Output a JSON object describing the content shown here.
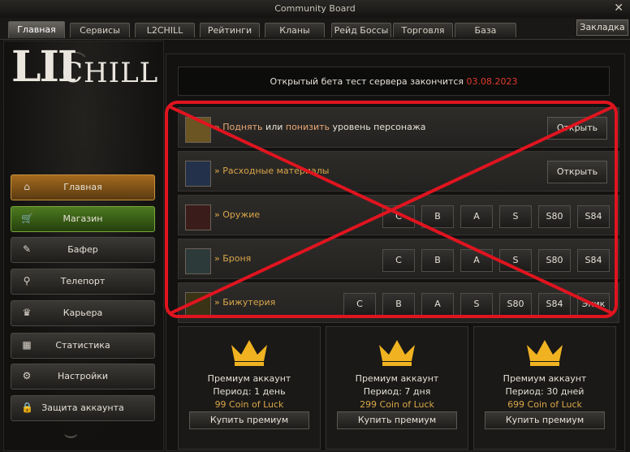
{
  "window": {
    "title": "Community Board",
    "close": "✕"
  },
  "tabs": [
    "Главная",
    "Сервисы",
    "L2CHILL",
    "Рейтинги",
    "Кланы",
    "Рейд Боссы",
    "Торговля",
    "База Данных"
  ],
  "bookmark_label": "Закладка",
  "logo": {
    "prefix": "LII",
    "text": "CHILL"
  },
  "sidebar": {
    "items": [
      {
        "label": "Главная",
        "icon": "⌂"
      },
      {
        "label": "Магазин",
        "icon": "🛒"
      },
      {
        "label": "Бафер",
        "icon": "✎"
      },
      {
        "label": "Телепорт",
        "icon": "⚲"
      },
      {
        "label": "Карьера",
        "icon": "♛"
      },
      {
        "label": "Статистика",
        "icon": "▦"
      },
      {
        "label": "Настройки",
        "icon": "⚙"
      },
      {
        "label": "Защита аккаунта",
        "icon": "🔒"
      }
    ]
  },
  "banner": {
    "text": "Открытый бета тест сервера закончится ",
    "date": "03.08.2023"
  },
  "level_row": {
    "arrow": "»",
    "raise": "Поднять",
    "or": " или ",
    "lower": "понизить",
    "rest": " уровень персонажа",
    "button": "Открыть"
  },
  "consumables_row": {
    "label": "» Расходные материалы",
    "button": "Открыть"
  },
  "weapons_row": {
    "label": "» Оружие",
    "grades": [
      "C",
      "B",
      "A",
      "S",
      "S80",
      "S84"
    ]
  },
  "armor_row": {
    "label": "» Броня",
    "grades": [
      "C",
      "B",
      "A",
      "S",
      "S80",
      "S84"
    ]
  },
  "jewelry_row": {
    "label": "» Бижутерия",
    "grades": [
      "C",
      "B",
      "A",
      "S",
      "S80",
      "S84",
      "Эпик"
    ]
  },
  "premium": [
    {
      "title": "Премиум аккаунт",
      "period": "Период: 1 день",
      "price": "99 Coin of Luck",
      "button": "Купить премиум"
    },
    {
      "title": "Премиум аккаунт",
      "period": "Период: 7 дня",
      "price": "299 Coin of Luck",
      "button": "Купить премиум"
    },
    {
      "title": "Премиум аккаунт",
      "period": "Период: 30 дней",
      "price": "699 Coin of Luck",
      "button": "Купить премиум"
    }
  ],
  "colors": {
    "accent": "#d9a64a",
    "date": "#e23b2b",
    "link": "#e9a877",
    "cross": "#e0141f"
  }
}
